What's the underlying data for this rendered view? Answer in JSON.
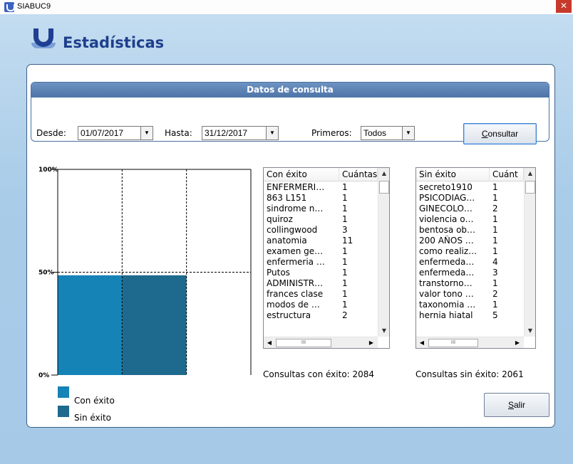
{
  "window": {
    "app_title": "SIABUC9",
    "close_glyph": "✕",
    "page_title": "Estadísticas"
  },
  "query": {
    "header": "Datos de consulta",
    "desde_label": "Desde:",
    "desde_value": "01/07/2017",
    "hasta_label": "Hasta:",
    "hasta_value": "31/12/2017",
    "primeros_label": "Primeros:",
    "primeros_value": "Todos",
    "consultar_first": "C",
    "consultar_rest": "onsultar"
  },
  "chart_data": {
    "type": "bar",
    "categories": [
      "Con éxito",
      "Sin éxito"
    ],
    "values": [
      2084,
      2061
    ],
    "percent_values": [
      48.5,
      48.5
    ],
    "ylim": [
      0,
      100
    ],
    "y_ticks": [
      "0%",
      "50%",
      "100%"
    ],
    "grid": true,
    "legend_placement": "bottom-left",
    "colors": [
      "#1583b6",
      "#1d6a8e"
    ]
  },
  "legend": [
    {
      "label": "Con éxito",
      "color": "#1583b6"
    },
    {
      "label": "Sin éxito",
      "color": "#1d6a8e"
    }
  ],
  "lists": {
    "con_exito": {
      "col1": "Con éxito",
      "col2": "Cuántas",
      "rows": [
        [
          "ENFERMERI…",
          "1"
        ],
        [
          "863 L151",
          "1"
        ],
        [
          "sindrome n…",
          "1"
        ],
        [
          "quiroz",
          "1"
        ],
        [
          "collingwood",
          "3"
        ],
        [
          "anatomia",
          "11"
        ],
        [
          "examen ge…",
          "1"
        ],
        [
          "enfermeria …",
          "1"
        ],
        [
          "Putos",
          "1"
        ],
        [
          "ADMINISTR…",
          "1"
        ],
        [
          "frances clase",
          "1"
        ],
        [
          "modos de …",
          "1"
        ],
        [
          "estructura",
          "2"
        ]
      ],
      "count_label": "Consultas con éxito: 2084"
    },
    "sin_exito": {
      "col1": "Sin éxito",
      "col2": "Cuánt",
      "rows": [
        [
          "secreto1910",
          "1"
        ],
        [
          "PSICODIAG…",
          "1"
        ],
        [
          "GINECOLO…",
          "2"
        ],
        [
          "violencia o…",
          "1"
        ],
        [
          "bentosa ob…",
          "1"
        ],
        [
          "200 AÑOS …",
          "1"
        ],
        [
          "como realiz…",
          "1"
        ],
        [
          "enfermeda…",
          "4"
        ],
        [
          "enfermeda…",
          "3"
        ],
        [
          "transtorno…",
          "1"
        ],
        [
          "valor tono …",
          "2"
        ],
        [
          "taxonomia …",
          "1"
        ],
        [
          "hernia hiatal",
          "5"
        ]
      ],
      "count_label": "Consultas sin éxito: 2061"
    }
  },
  "footer": {
    "salir_first": "S",
    "salir_rest": "alir"
  },
  "icons": {
    "dropdown": "▼",
    "scroll_up": "▲",
    "scroll_down": "▼",
    "scroll_left": "◀",
    "scroll_right": "▶",
    "grip": "III"
  }
}
